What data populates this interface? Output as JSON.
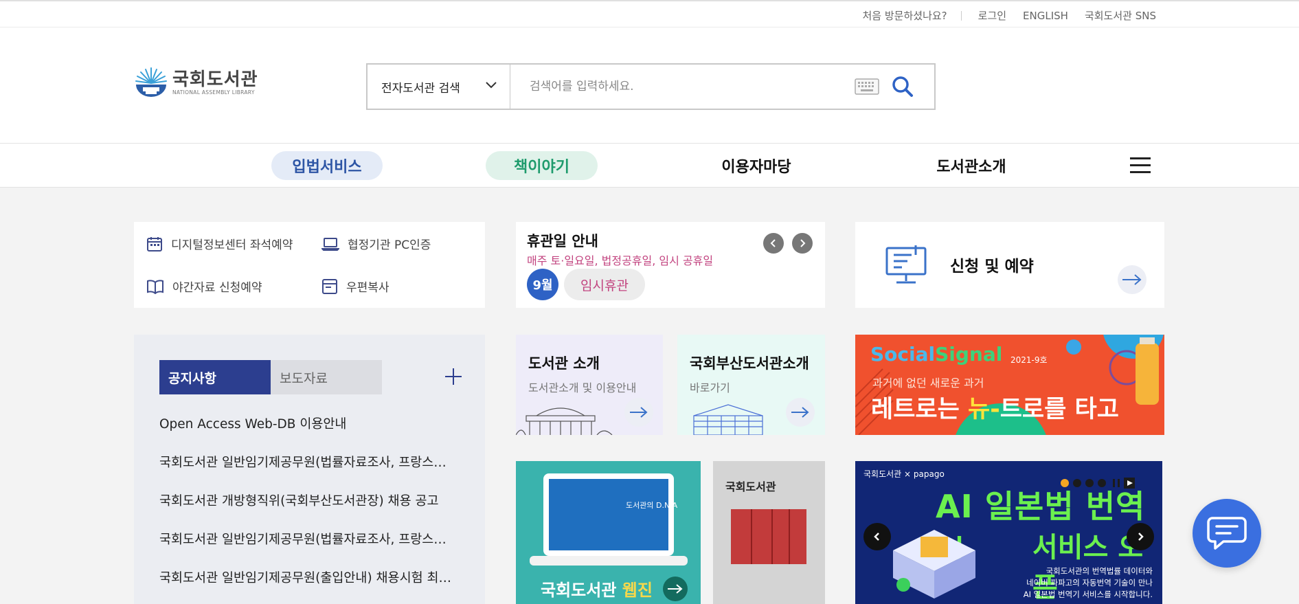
{
  "util": {
    "first_visit": "처음 방문하셨나요?",
    "login": "로그인",
    "english": "ENGLISH",
    "sns": "국회도서관 SNS"
  },
  "logo": {
    "name_ko": "국회도서관",
    "name_en": "NATIONAL ASSEMBLY LIBRARY"
  },
  "search": {
    "scope": "전자도서관 검색",
    "placeholder": "검색어를 입력하세요."
  },
  "gnb": [
    "입법서비스",
    "책이야기",
    "이용자마당",
    "도서관소개"
  ],
  "quick_links": [
    "디지털정보센터 좌석예약",
    "협정기관 PC인증",
    "야간자료 신청예약",
    "우편복사"
  ],
  "holiday": {
    "title": "휴관일 안내",
    "subtitle": "매주 토·일요일, 법정공휴일, 임시 공휴일",
    "month": "9월",
    "tag": "임시휴관"
  },
  "apply": {
    "label": "신청 및 예약"
  },
  "notice": {
    "tab_active": "공지사항",
    "tab_inactive": "보도자료",
    "items": [
      "Open Access Web-DB 이용안내",
      "국회도서관 일반임기제공무원(법률자료조사, 프랑스…",
      "국회도서관 개방형직위(국회부산도서관장) 채용 공고",
      "국회도서관 일반임기제공무원(법률자료조사, 프랑스…",
      "국회도서관 일반임기제공무원(출입안내) 채용시험 최…"
    ]
  },
  "cards": [
    {
      "title": "도서관 소개",
      "sub": "도서관소개 및 이용안내"
    },
    {
      "title": "국회부산도서관소개",
      "sub": "바로가기"
    }
  ],
  "social_signal": {
    "logo_a": "Social",
    "logo_b": "Signal",
    "issue": "2021-9호",
    "copy1": "과거에 없던 새로운 과거",
    "copy2_a": "레트로는 ",
    "copy2_b": "뉴-",
    "copy2_c": "트로를 타고"
  },
  "webzine": {
    "label_a": "국회도서관 ",
    "label_b": "웹진",
    "screen_title": "도서관의 D.N.A"
  },
  "magazine": {
    "title": "국회도서관"
  },
  "ai_banner": {
    "partners": "국회도서관 × papago",
    "title": "AI 일본법 번역기",
    "title2": "서비스 오픈",
    "desc": "국회도서관의 번역법률 데이터와\n네이버 파파고의 자동번역 기술이 만나\nAI 일본법 번역기 서비스를 시작합니다."
  },
  "colors": {
    "primary_blue": "#2e62c5",
    "notice_tab": "#2c3e8f",
    "green": "#1e9b6c",
    "pink": "#c2437f",
    "orange_banner": "#f0512e",
    "navy_banner": "#112675"
  }
}
